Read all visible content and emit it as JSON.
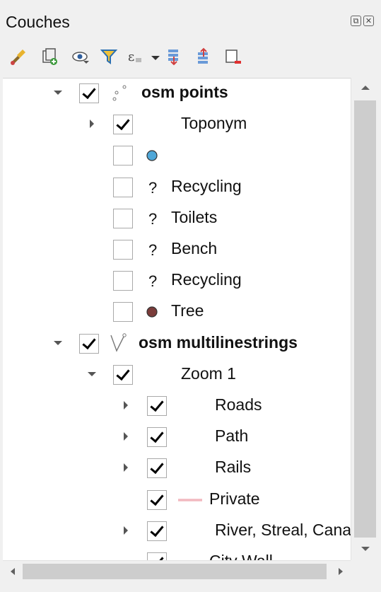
{
  "panel": {
    "title": "Couches"
  },
  "dock_buttons": {
    "float": "⧉",
    "close": "✕"
  },
  "toolbar": [
    {
      "name": "style-manager-icon"
    },
    {
      "name": "add-group-icon"
    },
    {
      "name": "manage-visibility-icon"
    },
    {
      "name": "filter-legend-icon"
    },
    {
      "name": "filter-expression-icon"
    },
    {
      "name": "expand-all-icon"
    },
    {
      "name": "collapse-all-icon"
    },
    {
      "name": "remove-layer-icon"
    }
  ],
  "tree": [
    {
      "label": "osm points",
      "bold": true,
      "checked": true,
      "arrow": "down",
      "symbol": "point-layer-icon"
    },
    {
      "label": "Toponym",
      "checked": true,
      "arrow": "right",
      "symbol": "none"
    },
    {
      "label": "",
      "checked": false,
      "symbol": "circle",
      "color": "#4fa7d8"
    },
    {
      "label": "Recycling",
      "checked": false,
      "symbol": "question",
      "glyph": "?"
    },
    {
      "label": "Toilets",
      "checked": false,
      "symbol": "question",
      "glyph": "?"
    },
    {
      "label": "Bench",
      "checked": false,
      "symbol": "question",
      "glyph": "?"
    },
    {
      "label": "Recycling",
      "checked": false,
      "symbol": "question",
      "glyph": "?"
    },
    {
      "label": "Tree",
      "checked": false,
      "symbol": "circle",
      "color": "#7a3c3a"
    },
    {
      "label": "osm multilinestrings",
      "bold": true,
      "checked": true,
      "arrow": "down",
      "symbol": "line-layer-icon"
    },
    {
      "label": "Zoom 1",
      "checked": true,
      "arrow": "down",
      "symbol": "none"
    },
    {
      "label": "Roads",
      "checked": true,
      "arrow": "right",
      "symbol": "none"
    },
    {
      "label": "Path",
      "checked": true,
      "arrow": "right",
      "symbol": "none"
    },
    {
      "label": "Rails",
      "checked": true,
      "arrow": "right",
      "symbol": "none"
    },
    {
      "label": "Private",
      "checked": true,
      "symbol": "line",
      "color": "#f2b8bf"
    },
    {
      "label": "River, Streal, Canal",
      "checked": true,
      "arrow": "right",
      "symbol": "none"
    },
    {
      "label": "City Wall",
      "checked": true,
      "symbol": "line",
      "color": "#555555"
    }
  ]
}
